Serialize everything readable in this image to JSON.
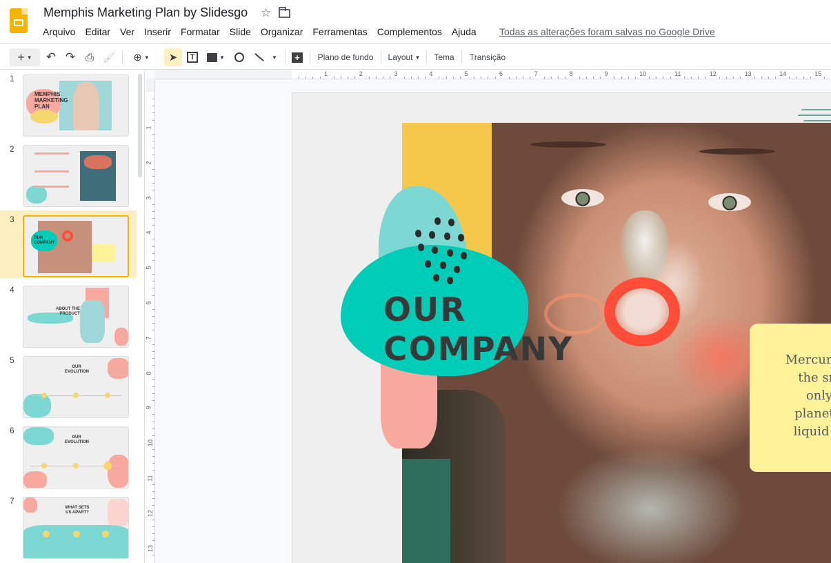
{
  "header": {
    "title": "Memphis Marketing Plan by Slidesgo",
    "saved_status": "Todas as alterações foram salvas no Google Drive",
    "menu": [
      "Arquivo",
      "Editar",
      "Ver",
      "Inserir",
      "Formatar",
      "Slide",
      "Organizar",
      "Ferramentas",
      "Complementos",
      "Ajuda"
    ]
  },
  "toolbar": {
    "add_icon": "+",
    "background_label": "Plano de fundo",
    "layout_label": "Layout",
    "theme_label": "Tema",
    "transition_label": "Transição"
  },
  "filmstrip": {
    "active_slide": 3,
    "slides": [
      {
        "number": "1",
        "label": "MEMPHIS MARKETING PLAN"
      },
      {
        "number": "2",
        "label": ""
      },
      {
        "number": "3",
        "label": "OUR COMPANY"
      },
      {
        "number": "4",
        "label": "ABOUT THE PRODUCT"
      },
      {
        "number": "5",
        "label": "OUR EVOLUTION"
      },
      {
        "number": "6",
        "label": "OUR EVOLUTION"
      },
      {
        "number": "7",
        "label": "WHAT SETS US APART?"
      }
    ]
  },
  "rulers": {
    "horizontal": [
      "1",
      "2",
      "3",
      "4",
      "5",
      "6",
      "7",
      "8",
      "9",
      "10",
      "11",
      "12",
      "13",
      "14",
      "15"
    ],
    "vertical": [
      "1",
      "2",
      "3",
      "4",
      "5",
      "6",
      "7",
      "8",
      "9",
      "10",
      "11",
      "12",
      "13"
    ]
  },
  "slide": {
    "title_line1": "OUR",
    "title_line2": "COMPANY",
    "note_text": "Mercury is\nthe sm\nonly\nplanet's\nliquid m"
  },
  "colors": {
    "accent": "#f4b400",
    "teal": "#00cdb7",
    "pink": "#f7a9a0",
    "yellow_note": "#fff39a"
  }
}
